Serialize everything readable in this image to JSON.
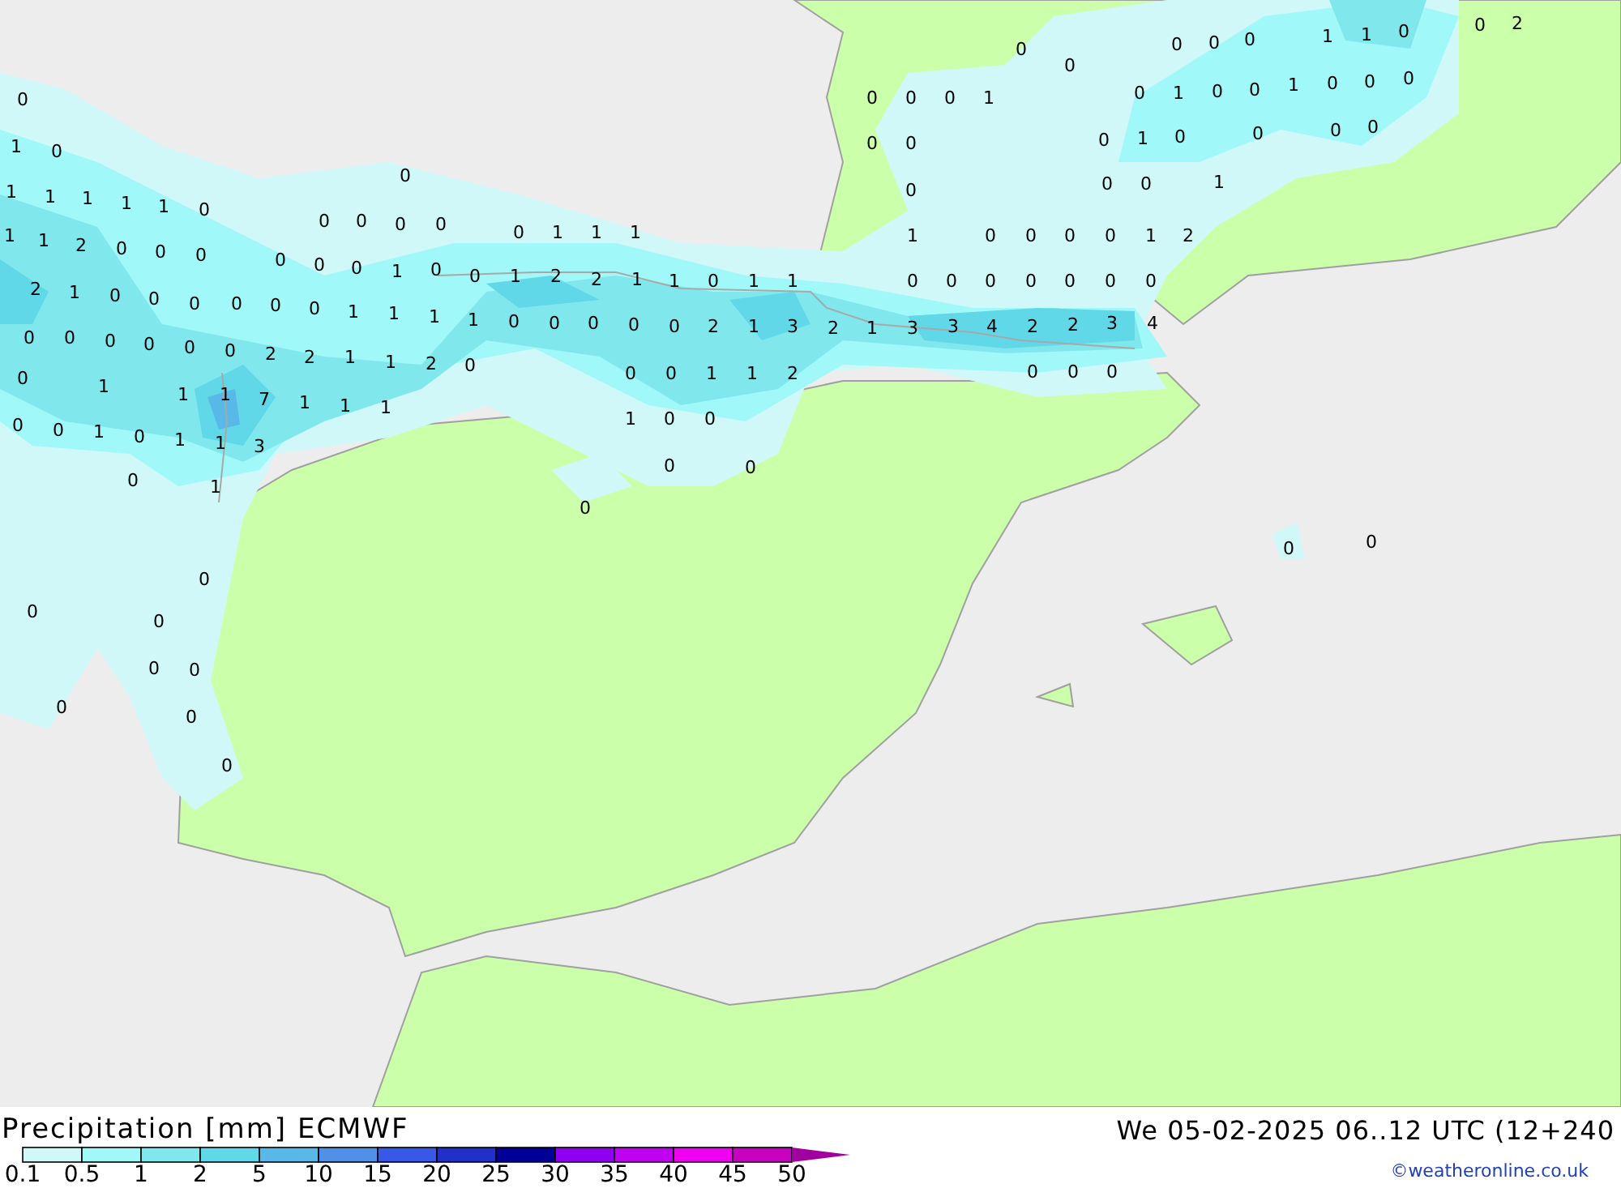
{
  "map": {
    "values": [
      "0",
      "1",
      "0",
      "1",
      "1",
      "1",
      "1",
      "1",
      "0",
      "1",
      "1",
      "2",
      "0",
      "0",
      "0",
      "2",
      "1",
      "0",
      "0",
      "0",
      "0",
      "0",
      "0",
      "0",
      "0",
      "0",
      "1",
      "1",
      "1",
      "0",
      "0",
      "0",
      "1",
      "0",
      "0",
      "1",
      "2",
      "2",
      "1",
      "1",
      "0",
      "1",
      "1",
      "1",
      "0",
      "0",
      "0",
      "0",
      "1",
      "2",
      "0",
      "0",
      "0",
      "0",
      "0",
      "0",
      "0",
      "0",
      "0",
      "0",
      "1",
      "1",
      "1",
      "1",
      "0",
      "0",
      "0",
      "0",
      "0",
      "2",
      "1",
      "3",
      "2",
      "1",
      "3",
      "3",
      "4",
      "2",
      "2",
      "3",
      "4",
      "0",
      "0",
      "0",
      "0",
      "0",
      "0",
      "2",
      "2",
      "1",
      "1",
      "2",
      "0",
      "0",
      "1",
      "0",
      "0",
      "1",
      "1",
      "2",
      "0",
      "0",
      "0",
      "1",
      "1",
      "7",
      "1",
      "1",
      "1",
      "0",
      "0",
      "1",
      "0",
      "1",
      "1",
      "3",
      "1",
      "0",
      "0",
      "0",
      "0",
      "0",
      "1",
      "0",
      "0",
      "0",
      "0",
      "0",
      "0",
      "0",
      "0",
      "0",
      "0",
      "0",
      "0",
      "0",
      "0",
      "0",
      "1",
      "1",
      "0",
      "0",
      "2",
      "0",
      "0",
      "0",
      "0",
      "0",
      "0",
      "1",
      "0",
      "0",
      "1",
      "0",
      "0",
      "0",
      "0",
      "1",
      "0",
      "0",
      "0",
      "0",
      "0",
      "0",
      "1",
      "0",
      "1",
      "0"
    ]
  },
  "footer": {
    "title": "Precipitation [mm] ECMWF",
    "datetime": "We 05-02-2025 06..12 UTC (12+240",
    "credit": "©weatheronline.co.uk"
  },
  "legend": [
    {
      "label": "0.1",
      "color": "#d0f8f8"
    },
    {
      "label": "0.5",
      "color": "#a0f8f8"
    },
    {
      "label": "1",
      "color": "#80e8ec"
    },
    {
      "label": "2",
      "color": "#60d8e8"
    },
    {
      "label": "5",
      "color": "#58b8e8"
    },
    {
      "label": "10",
      "color": "#5090e8"
    },
    {
      "label": "15",
      "color": "#3858e8"
    },
    {
      "label": "20",
      "color": "#2030c8"
    },
    {
      "label": "25",
      "color": "#000098"
    },
    {
      "label": "30",
      "color": "#9000f0"
    },
    {
      "label": "35",
      "color": "#c000f0"
    },
    {
      "label": "40",
      "color": "#f000f0"
    },
    {
      "label": "45",
      "color": "#c800c0"
    },
    {
      "label": "50",
      "color": "#a000a0"
    }
  ]
}
